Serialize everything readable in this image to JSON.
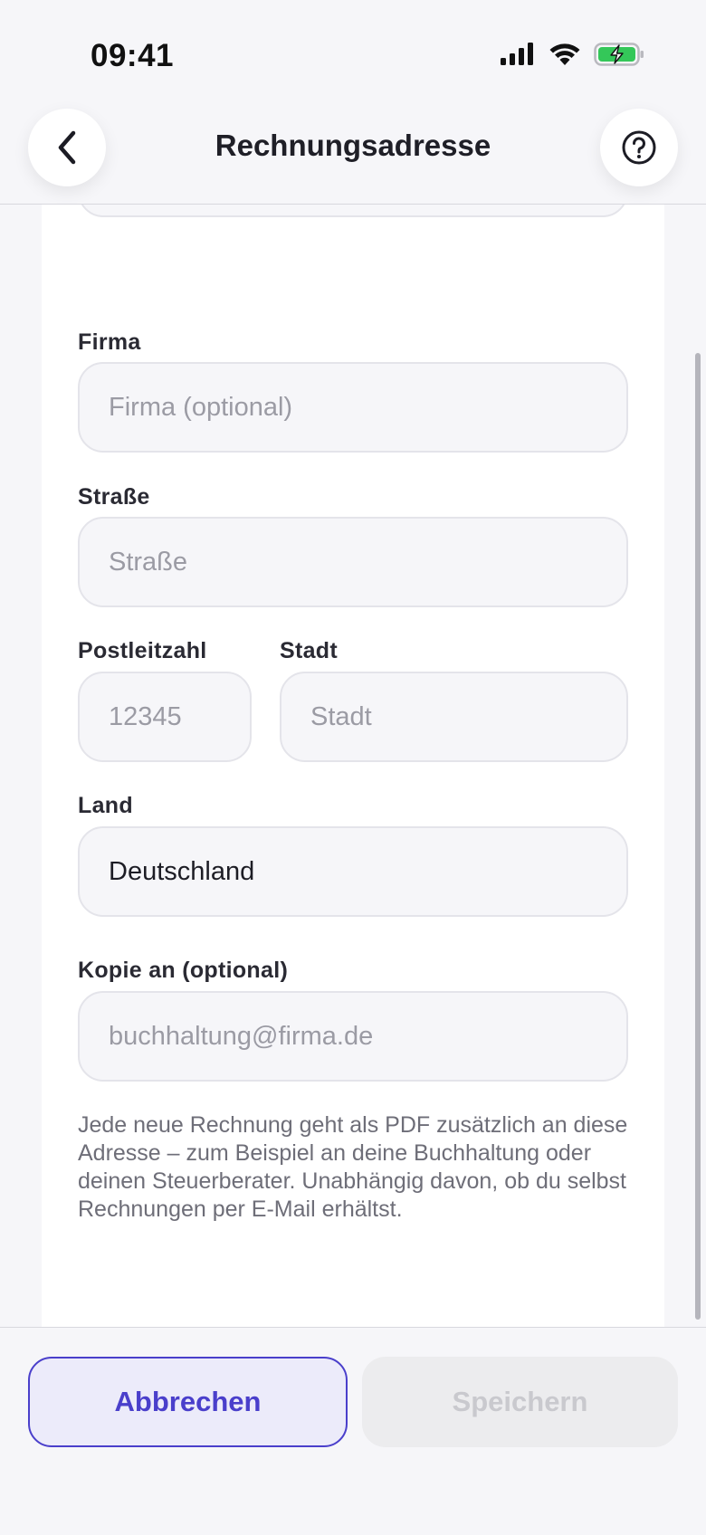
{
  "status_bar": {
    "time": "09:41",
    "accent": "#34c759"
  },
  "nav": {
    "title": "Rechnungsadresse"
  },
  "address": {
    "company_label": "Firma",
    "company_placeholder": "Firma (optional)",
    "street_label": "Straße",
    "street_placeholder": "Straße",
    "zip_label": "Postleitzahl",
    "zip_placeholder": "12345",
    "city_label": "Stadt",
    "city_placeholder": "Stadt",
    "country_label": "Land",
    "country_value": "Deutschland"
  },
  "copy": {
    "label": "Kopie an (optional)",
    "placeholder": "buchhaltung@firma.de",
    "hint": "Jede neue Rechnung geht als PDF zusätzlich an diese Adresse – zum Beispiel an deine Buchhaltung oder deinen Steuerberater. Unabhängig davon, ob du selbst Rechnungen per E-Mail erhältst."
  },
  "actions": {
    "cancel_label": "Abbrechen",
    "save_label": "Speichern",
    "brand_color": "#4a3fcb"
  }
}
